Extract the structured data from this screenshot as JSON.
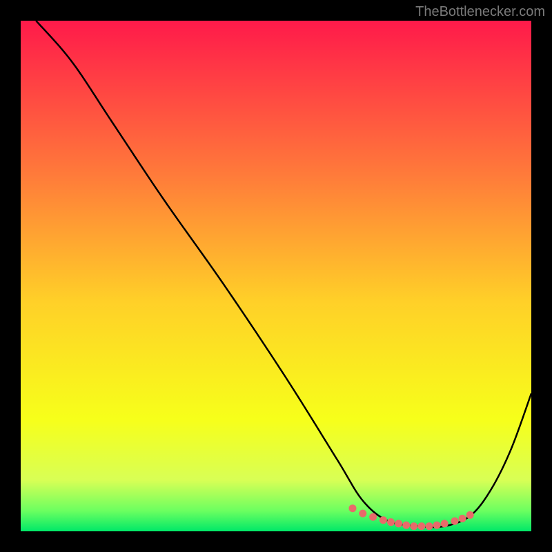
{
  "watermark": "TheBottlenecker.com",
  "chart_data": {
    "type": "line",
    "title": "",
    "xlabel": "",
    "ylabel": "",
    "xlim": [
      0,
      100
    ],
    "ylim": [
      0,
      100
    ],
    "gradient_stops": [
      {
        "offset": 0,
        "color": "#ff1a4a"
      },
      {
        "offset": 30,
        "color": "#ff7a3a"
      },
      {
        "offset": 55,
        "color": "#ffd028"
      },
      {
        "offset": 78,
        "color": "#f7ff1a"
      },
      {
        "offset": 90,
        "color": "#d8ff55"
      },
      {
        "offset": 96,
        "color": "#6bff60"
      },
      {
        "offset": 100,
        "color": "#00e868"
      }
    ],
    "series": [
      {
        "name": "bottleneck-curve",
        "color": "#000000",
        "x": [
          3,
          10,
          18,
          28,
          40,
          52,
          62,
          67,
          72,
          78,
          83,
          88,
          92,
          96,
          100
        ],
        "y": [
          100,
          92,
          80,
          65,
          48,
          30,
          14,
          6,
          2,
          1,
          1,
          3,
          8,
          16,
          27
        ]
      }
    ],
    "markers": {
      "name": "optimal-range",
      "color": "#e86a6a",
      "x": [
        65,
        67,
        69,
        71,
        72.5,
        74,
        75.5,
        77,
        78.5,
        80,
        81.5,
        83,
        85,
        86.5,
        88
      ],
      "y": [
        4.5,
        3.5,
        2.8,
        2.2,
        1.8,
        1.5,
        1.2,
        1.0,
        1.0,
        1.0,
        1.2,
        1.5,
        2.0,
        2.5,
        3.2
      ]
    }
  }
}
